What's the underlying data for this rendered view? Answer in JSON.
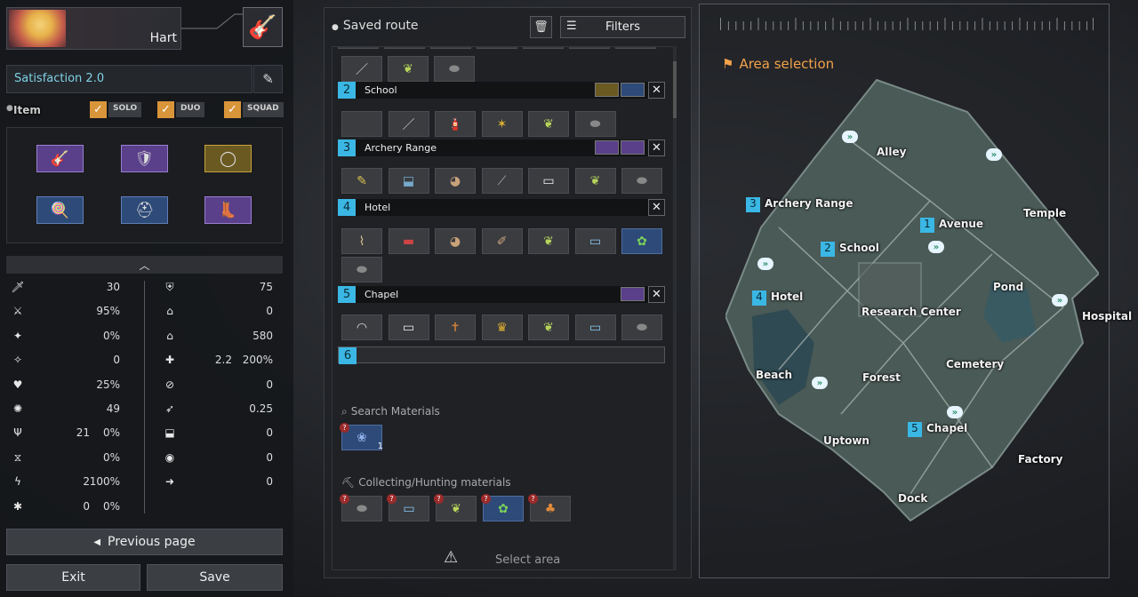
{
  "character": {
    "name": "Hart",
    "weapon_icon": "guitar-icon"
  },
  "route": {
    "name": "Satisfaction 2.0"
  },
  "item_filter": {
    "label": "Item",
    "modes": [
      "SOLO",
      "DUO",
      "SQUAD"
    ]
  },
  "equipment": [
    {
      "icon": "guitar-icon",
      "rarity": "purple"
    },
    {
      "icon": "armor-icon",
      "rarity": "purple"
    },
    {
      "icon": "wreath-icon",
      "rarity": "gold"
    },
    {
      "icon": "mace-icon",
      "rarity": "blue"
    },
    {
      "icon": "helmet-icon",
      "rarity": "blue"
    },
    {
      "icon": "boots-icon",
      "rarity": "purple"
    }
  ],
  "stats_left": [
    {
      "icon": "sword-icon",
      "v1": "",
      "v2": "30"
    },
    {
      "icon": "attack-speed-icon",
      "v1": "",
      "v2": "95%"
    },
    {
      "icon": "crit-icon",
      "v1": "",
      "v2": "0%"
    },
    {
      "icon": "crit-dmg-icon",
      "v1": "",
      "v2": "0"
    },
    {
      "icon": "lifesteal-icon",
      "v1": "",
      "v2": "25%"
    },
    {
      "icon": "skill-amp-icon",
      "v1": "",
      "v2": "49"
    },
    {
      "icon": "trident-icon",
      "v1": "21",
      "v2": "0%"
    },
    {
      "icon": "hourglass-icon",
      "v1": "",
      "v2": "0%"
    },
    {
      "icon": "zigzag-icon",
      "v1": "2",
      "v2": "100%"
    },
    {
      "icon": "splash-icon",
      "v1": "0",
      "v2": "0%"
    }
  ],
  "stats_right": [
    {
      "icon": "shield-icon",
      "v1": "",
      "v2": "75"
    },
    {
      "icon": "house-up-icon",
      "v1": "",
      "v2": "0"
    },
    {
      "icon": "house-icon",
      "v1": "",
      "v2": "580"
    },
    {
      "icon": "plus-icon",
      "v1": "2.2",
      "v2": "200%"
    },
    {
      "icon": "slash-icon",
      "v1": "",
      "v2": "0"
    },
    {
      "icon": "boot-speed-icon",
      "v1": "",
      "v2": "0.25"
    },
    {
      "icon": "boot-icon",
      "v1": "",
      "v2": "0"
    },
    {
      "icon": "eye-icon",
      "v1": "",
      "v2": "0"
    },
    {
      "icon": "arrow-right-icon",
      "v1": "",
      "v2": "0"
    }
  ],
  "buttons": {
    "previous": "Previous page",
    "exit": "Exit",
    "save": "Save"
  },
  "saved_route": {
    "title": "Saved route",
    "filters": "Filters"
  },
  "route_sections": [
    {
      "num": "2",
      "name": "School",
      "badges": [
        "gold",
        "blue"
      ],
      "items": [
        "blue-dark",
        "pipe",
        "dagger",
        "gold-dark",
        "herb",
        "stone"
      ]
    },
    {
      "num": "3",
      "name": "Archery Range",
      "badges": [
        "purple",
        "purple"
      ],
      "items": [
        "pen",
        "shoe",
        "bag",
        "needle",
        "paper",
        "herb",
        "stone"
      ]
    },
    {
      "num": "4",
      "name": "Hotel",
      "badges": [],
      "items": [
        "scroll",
        "gun",
        "bag",
        "feather",
        "herb",
        "bottle",
        "leaf",
        "stone"
      ]
    },
    {
      "num": "5",
      "name": "Chapel",
      "badges": [
        "purple"
      ],
      "items": [
        "fan",
        "paper",
        "cross",
        "trophy",
        "herb",
        "bottle",
        "stone"
      ]
    },
    {
      "num": "6",
      "name": "",
      "badges": [],
      "items": []
    }
  ],
  "search_materials": {
    "title": "Search Materials",
    "count": "1"
  },
  "collecting": {
    "title": "Collecting/Hunting materials"
  },
  "bottom": {
    "select_area": "Select area"
  },
  "map": {
    "title": "Area selection",
    "areas": [
      {
        "name": "Alley"
      },
      {
        "name": "Temple"
      },
      {
        "name": "Archery Range",
        "num": "3"
      },
      {
        "name": "Avenue",
        "num": "1"
      },
      {
        "name": "School",
        "num": "2"
      },
      {
        "name": "Hotel",
        "num": "4"
      },
      {
        "name": "Pond"
      },
      {
        "name": "Research Center"
      },
      {
        "name": "Hospital"
      },
      {
        "name": "Beach"
      },
      {
        "name": "Forest"
      },
      {
        "name": "Cemetery"
      },
      {
        "name": "Chapel",
        "num": "5"
      },
      {
        "name": "Uptown"
      },
      {
        "name": "Factory"
      },
      {
        "name": "Dock"
      }
    ]
  }
}
